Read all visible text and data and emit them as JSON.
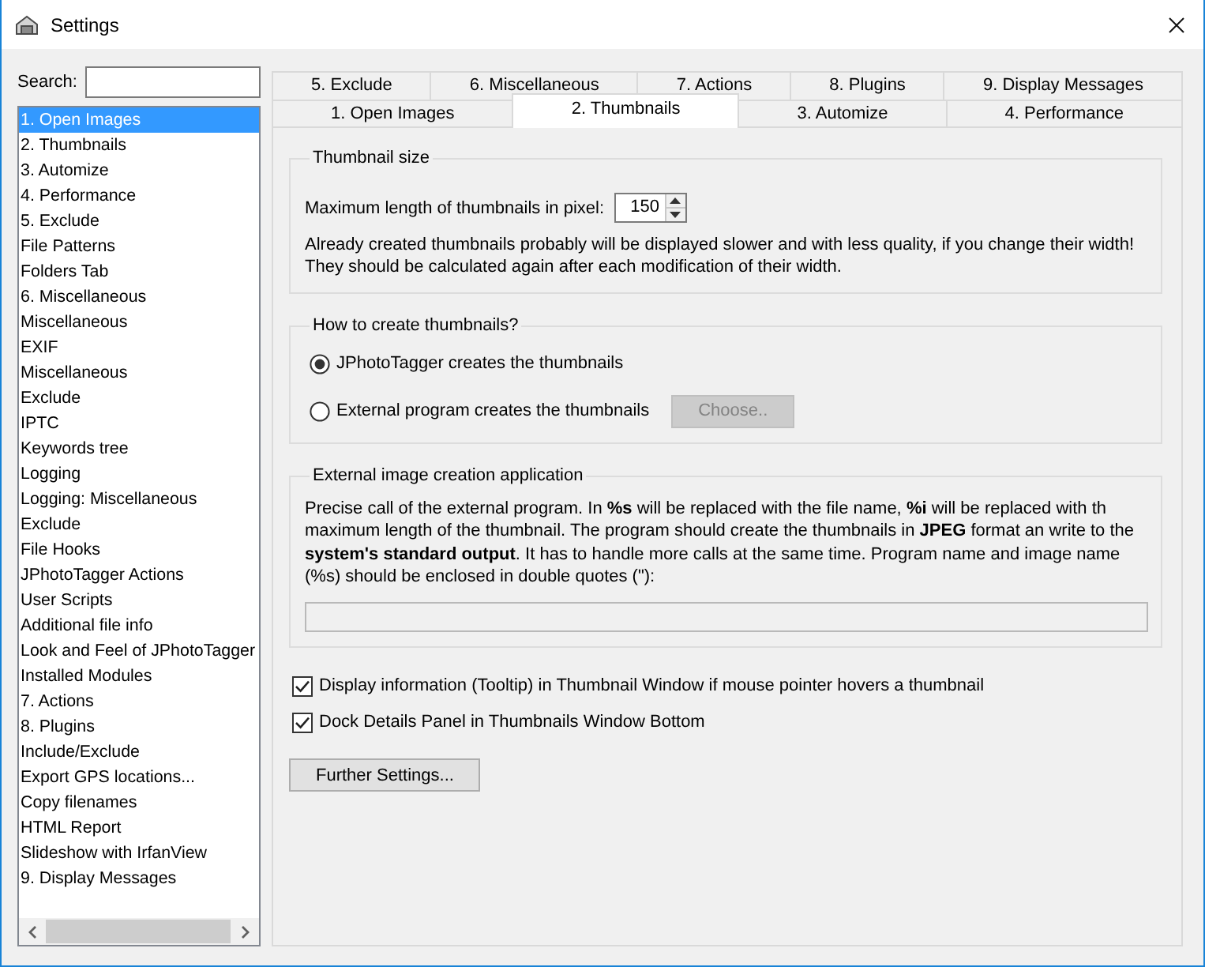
{
  "window": {
    "title": "Settings"
  },
  "search": {
    "label": "Search:"
  },
  "sidebar": {
    "items": [
      {
        "label": "1. Open Images",
        "selected": true
      },
      {
        "label": "2. Thumbnails",
        "selected": false
      },
      {
        "label": "3. Automize",
        "selected": false
      },
      {
        "label": "4. Performance",
        "selected": false
      },
      {
        "label": "5. Exclude",
        "selected": false
      },
      {
        "label": "File Patterns",
        "selected": false
      },
      {
        "label": "Folders Tab",
        "selected": false
      },
      {
        "label": "6. Miscellaneous",
        "selected": false
      },
      {
        "label": "Miscellaneous",
        "selected": false
      },
      {
        "label": "EXIF",
        "selected": false
      },
      {
        "label": "Miscellaneous",
        "selected": false
      },
      {
        "label": "Exclude",
        "selected": false
      },
      {
        "label": "IPTC",
        "selected": false
      },
      {
        "label": "Keywords tree",
        "selected": false
      },
      {
        "label": "Logging",
        "selected": false
      },
      {
        "label": "Logging: Miscellaneous",
        "selected": false
      },
      {
        "label": "Exclude",
        "selected": false
      },
      {
        "label": "File Hooks",
        "selected": false
      },
      {
        "label": "JPhotoTagger Actions",
        "selected": false
      },
      {
        "label": "User Scripts",
        "selected": false
      },
      {
        "label": "Additional file info",
        "selected": false
      },
      {
        "label": "Look and Feel of JPhotoTagger",
        "selected": false
      },
      {
        "label": "Installed Modules",
        "selected": false
      },
      {
        "label": "7. Actions",
        "selected": false
      },
      {
        "label": "8. Plugins",
        "selected": false
      },
      {
        "label": "Include/Exclude",
        "selected": false
      },
      {
        "label": "Export GPS locations...",
        "selected": false
      },
      {
        "label": "Copy filenames",
        "selected": false
      },
      {
        "label": "HTML Report",
        "selected": false
      },
      {
        "label": "Slideshow with IrfanView",
        "selected": false
      },
      {
        "label": "9. Display Messages",
        "selected": false
      }
    ]
  },
  "tab_rows": [
    {
      "tabs": [
        {
          "label": "5. Exclude",
          "selected": false
        },
        {
          "label": "6. Miscellaneous",
          "selected": false
        },
        {
          "label": "7. Actions",
          "selected": false
        },
        {
          "label": "8. Plugins",
          "selected": false
        },
        {
          "label": "9. Display Messages",
          "selected": false
        }
      ]
    },
    {
      "tabs": [
        {
          "label": "1. Open Images",
          "selected": false
        },
        {
          "label": "2. Thumbnails",
          "selected": true
        },
        {
          "label": "3. Automize",
          "selected": false
        },
        {
          "label": "4. Performance",
          "selected": false
        }
      ]
    }
  ],
  "thumbnail_size": {
    "title": "Thumbnail size",
    "label": "Maximum length of thumbnails in pixel:",
    "value": "150",
    "note_lines": [
      "Already created thumbnails probably will be displayed slower and with less quality, if you change their width!",
      "They should be calculated again after each modification of their width."
    ]
  },
  "creation_method": {
    "title": "How to create thumbnails?",
    "options": [
      {
        "label": "JPhotoTagger creates the thumbnails",
        "selected": true
      },
      {
        "label": "External program creates the thumbnails",
        "selected": false
      }
    ],
    "choose_button": {
      "label": "Choose..",
      "disabled": true
    }
  },
  "external_application": {
    "title": "External image creation application",
    "description_lines": [
      "Precise call of the external program. In **%s** will be replaced with the file name, **%i** will be replaced with th",
      "maximum length of the thumbnail. The program should create the thumbnails in **JPEG** format an write to the",
      "**system's standard output**. It has to handle more calls at the same time. Program name and image name",
      "(%s) should be enclosed in double quotes (\"):"
    ],
    "command_field": {
      "disabled": true
    }
  },
  "checkboxes": [
    {
      "label": "Display information (Tooltip) in Thumbnail Window if mouse pointer hovers a thumbnail",
      "checked": true
    },
    {
      "label": "Dock Details Panel in Thumbnails Window Bottom",
      "checked": true
    }
  ],
  "further_settings_button": {
    "label": "Further Settings..."
  }
}
